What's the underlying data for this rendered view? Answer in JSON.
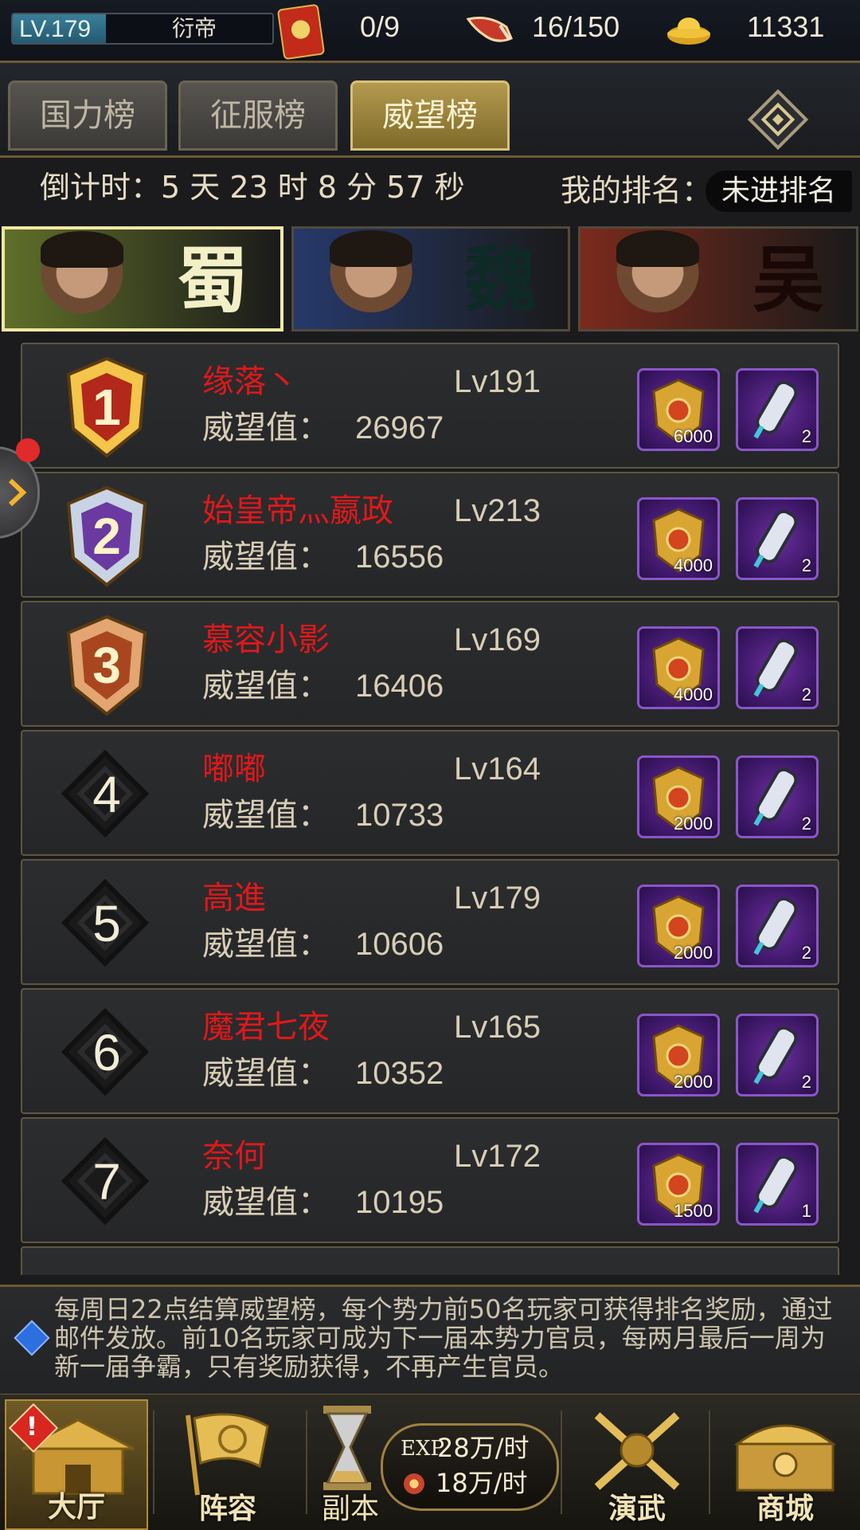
{
  "status_bar": {
    "level": "LV.179",
    "level_progress": 0.36,
    "vip_title": "衍帝",
    "card_count": "0/9",
    "stamina": "16/150",
    "gold": "11331"
  },
  "tabs": [
    {
      "label": "国力榜",
      "active": false
    },
    {
      "label": "征服榜",
      "active": false
    },
    {
      "label": "威望榜",
      "active": true
    }
  ],
  "info": {
    "countdown": "倒计时：5 天 23 时 8 分 57 秒",
    "my_rank_label": "我的排名：",
    "my_rank_value": "未进排名"
  },
  "factions": [
    {
      "name": "蜀",
      "active": true,
      "bg": "#5f6f28",
      "glyph_color": "#f3f0c8"
    },
    {
      "name": "魏",
      "active": false,
      "bg": "#26396a",
      "glyph_color": "#0d2a26"
    },
    {
      "name": "吴",
      "active": false,
      "bg": "#7b2a1c",
      "glyph_color": "#1a0806"
    }
  ],
  "score_label": "威望值：",
  "rankings": [
    {
      "rank": "1",
      "name": "缘落丶",
      "level": "Lv191",
      "score": "26967",
      "reward1": "6000",
      "reward2": "2"
    },
    {
      "rank": "2",
      "name": "始皇帝灬嬴政",
      "level": "Lv213",
      "score": "16556",
      "reward1": "4000",
      "reward2": "2"
    },
    {
      "rank": "3",
      "name": "慕容小影",
      "level": "Lv169",
      "score": "16406",
      "reward1": "4000",
      "reward2": "2"
    },
    {
      "rank": "4",
      "name": "嘟嘟",
      "level": "Lv164",
      "score": "10733",
      "reward1": "2000",
      "reward2": "2"
    },
    {
      "rank": "5",
      "name": "高進",
      "level": "Lv179",
      "score": "10606",
      "reward1": "2000",
      "reward2": "2"
    },
    {
      "rank": "6",
      "name": "魔君七夜",
      "level": "Lv165",
      "score": "10352",
      "reward1": "2000",
      "reward2": "2"
    },
    {
      "rank": "7",
      "name": "奈何",
      "level": "Lv172",
      "score": "10195",
      "reward1": "1500",
      "reward2": "1"
    }
  ],
  "notice": "每周日22点结算威望榜，每个势力前50名玩家可获得排名奖励，通过邮件发放。前10名玩家可成为下一届本势力官员，每两月最后一周为新一届争霸，只有奖励获得，不再产生官员。",
  "bottom_nav": {
    "hall": "大厅",
    "lineup": "阵容",
    "dungeon": "副本",
    "exp_label": "EXP",
    "exp_rate": "28万/时",
    "coin_rate": "18万/时",
    "martial": "演武",
    "shop": "商城"
  },
  "colors": {
    "accent_gold": "#b39a4f",
    "player_name_red": "#e0181a",
    "reward_purple": "#8a56c8"
  }
}
